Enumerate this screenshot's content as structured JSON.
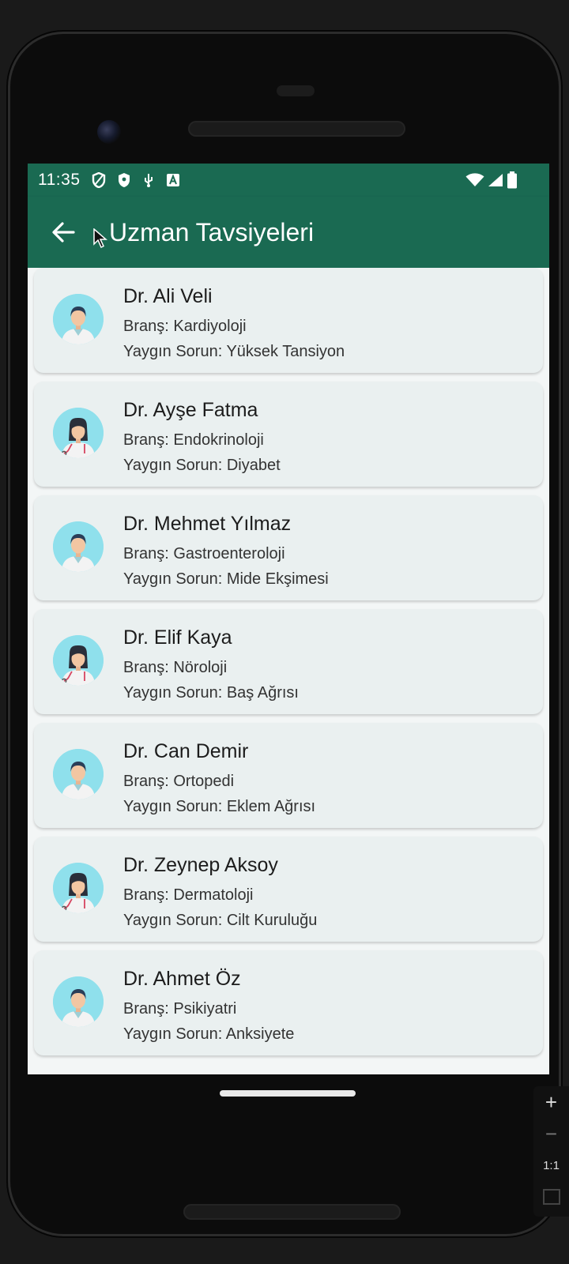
{
  "status_bar": {
    "time": "11:35",
    "left_icons": [
      "shield-outline-icon",
      "shield-filled-icon",
      "usb-icon",
      "contact-box-icon"
    ],
    "right_icons": [
      "wifi-icon",
      "signal-icon",
      "battery-icon"
    ]
  },
  "app_bar": {
    "title": "Uzman Tavsiyeleri",
    "background": "#1a6a52",
    "back_icon": "arrow-left-icon"
  },
  "experts": [
    {
      "name": "Dr. Ali Veli",
      "branch": "Branş: Kardiyoloji",
      "problem": "Yaygın Sorun: Yüksek Tansiyon",
      "avatar": "doctor-male-avatar"
    },
    {
      "name": "Dr. Ayşe Fatma",
      "branch": "Branş: Endokrinoloji",
      "problem": "Yaygın Sorun: Diyabet",
      "avatar": "doctor-female-avatar"
    },
    {
      "name": "Dr. Mehmet Yılmaz",
      "branch": "Branş: Gastroenteroloji",
      "problem": "Yaygın Sorun: Mide Ekşimesi",
      "avatar": "doctor-male-avatar"
    },
    {
      "name": "Dr. Elif Kaya",
      "branch": "Branş: Nöroloji",
      "problem": "Yaygın Sorun: Baş Ağrısı",
      "avatar": "doctor-female-avatar"
    },
    {
      "name": "Dr. Can Demir",
      "branch": "Branş: Ortopedi",
      "problem": "Yaygın Sorun: Eklem Ağrısı",
      "avatar": "doctor-male-avatar"
    },
    {
      "name": "Dr. Zeynep Aksoy",
      "branch": "Branş: Dermatoloji",
      "problem": "Yaygın Sorun: Cilt Kuruluğu",
      "avatar": "doctor-female-avatar"
    },
    {
      "name": "Dr. Ahmet Öz",
      "branch": "Branş: Psikiyatri",
      "problem": "Yaygın Sorun: Anksiyete",
      "avatar": "doctor-male-avatar"
    }
  ],
  "emulator_zoom": {
    "plus": "+",
    "minus": "−",
    "ratio": "1:1"
  }
}
